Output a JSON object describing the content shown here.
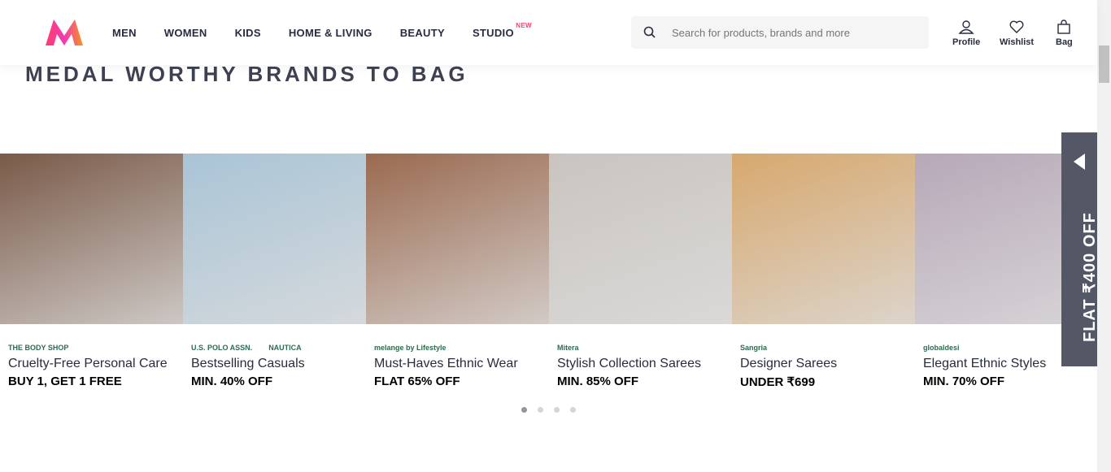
{
  "header": {
    "nav": [
      "MEN",
      "WOMEN",
      "KIDS",
      "HOME & LIVING",
      "BEAUTY",
      "STUDIO"
    ],
    "studio_badge": "NEW",
    "search_placeholder": "Search for products, brands and more",
    "profile": "Profile",
    "wishlist": "Wishlist",
    "bag": "Bag"
  },
  "section_title": "MEDAL WORTHY BRANDS TO BAG",
  "cards": [
    {
      "brands": [
        "THE BODY SHOP"
      ],
      "name": "Cruelty-Free Personal Care",
      "offer": "BUY 1, GET 1 FREE",
      "color": "#7a5a48"
    },
    {
      "brands": [
        "U.S. POLO ASSN.",
        "NAUTICA"
      ],
      "name": "Bestselling Casuals",
      "offer": "MIN. 40% OFF",
      "color": "#a9c4d6"
    },
    {
      "brands": [
        "melange by Lifestyle"
      ],
      "name": "Must-Haves Ethnic Wear",
      "offer": "FLAT 65% OFF",
      "color": "#9a6a50"
    },
    {
      "brands": [
        "Mitera"
      ],
      "name": "Stylish Collection Sarees",
      "offer": "MIN. 85% OFF",
      "color": "#c9c4bf"
    },
    {
      "brands": [
        "Sangria"
      ],
      "name": "Designer Sarees",
      "offer": "UNDER ₹699",
      "color": "#d7a86e"
    },
    {
      "brands": [
        "globaldesi"
      ],
      "name": "Elegant Ethnic Styles",
      "offer": "MIN. 70% OFF",
      "color": "#b7a8b8"
    }
  ],
  "side_banner": "FLAT ₹400 OFF"
}
